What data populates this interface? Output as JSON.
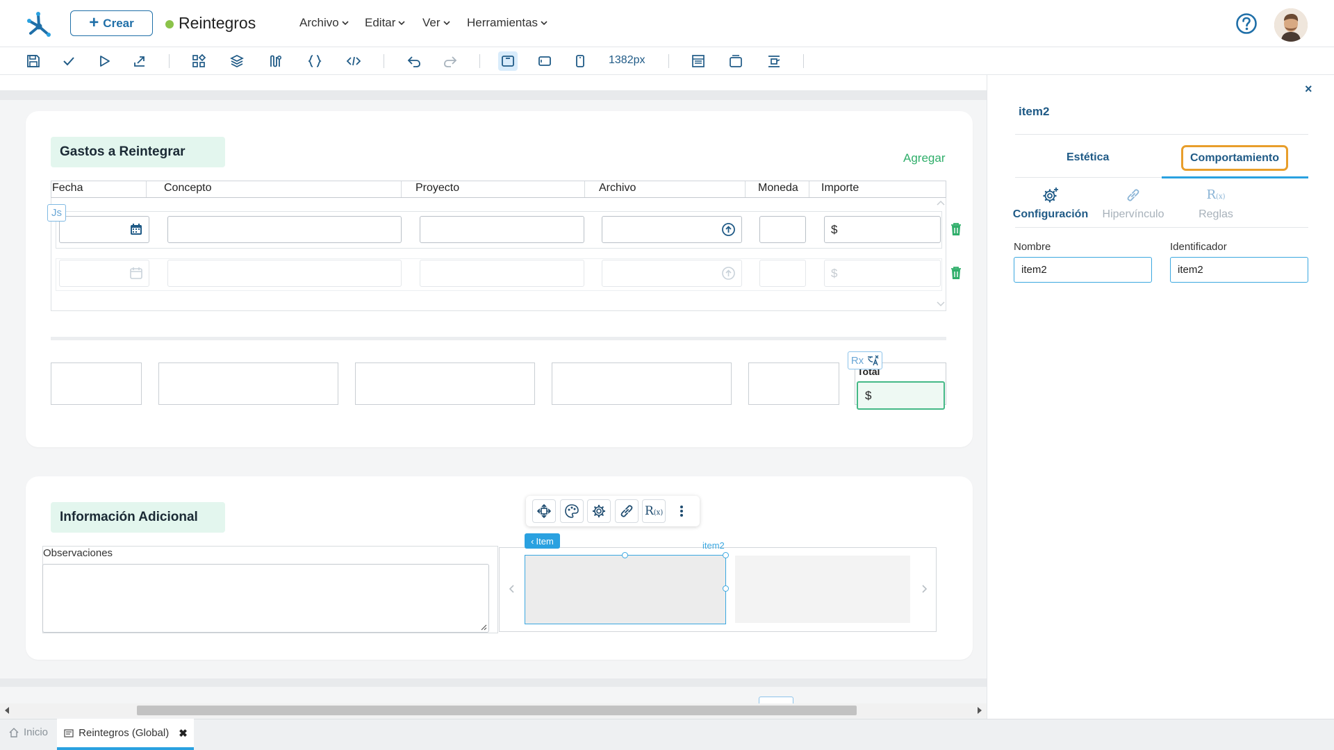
{
  "header": {
    "crear_label": "Crear",
    "app_title": "Reintegros",
    "menus": [
      "Archivo",
      "Editar",
      "Ver",
      "Herramientas"
    ]
  },
  "toolbar": {
    "width_readout": "1382px"
  },
  "section1": {
    "title": "Gastos a Reintegrar",
    "add_link": "Agregar",
    "columns": [
      "Fecha",
      "Concepto",
      "Proyecto",
      "Archivo",
      "Moneda",
      "Importe"
    ],
    "currency_symbol": "$",
    "js_badge": "Js",
    "rx_badge": "Rx",
    "total_label": "Total",
    "total_value": "$"
  },
  "section2": {
    "title": "Información Adicional",
    "observaciones_label": "Observaciones",
    "item_tag": "Item",
    "item_caption": "item2"
  },
  "panel": {
    "title": "item2",
    "tabs": [
      "Estética",
      "Comportamiento"
    ],
    "subtabs": [
      "Configuración",
      "Hipervínculo",
      "Reglas"
    ],
    "nombre_label": "Nombre",
    "nombre_value": "item2",
    "identificador_label": "Identificador",
    "identificador_value": "item2"
  },
  "bottom_tabs": {
    "inicio": "Inicio",
    "current": "Reintegros (Global)"
  },
  "colors": {
    "primary": "#1f6fa8",
    "accent": "#2aa1e0",
    "green": "#2fae6a",
    "highlight": "#e89e2b"
  }
}
